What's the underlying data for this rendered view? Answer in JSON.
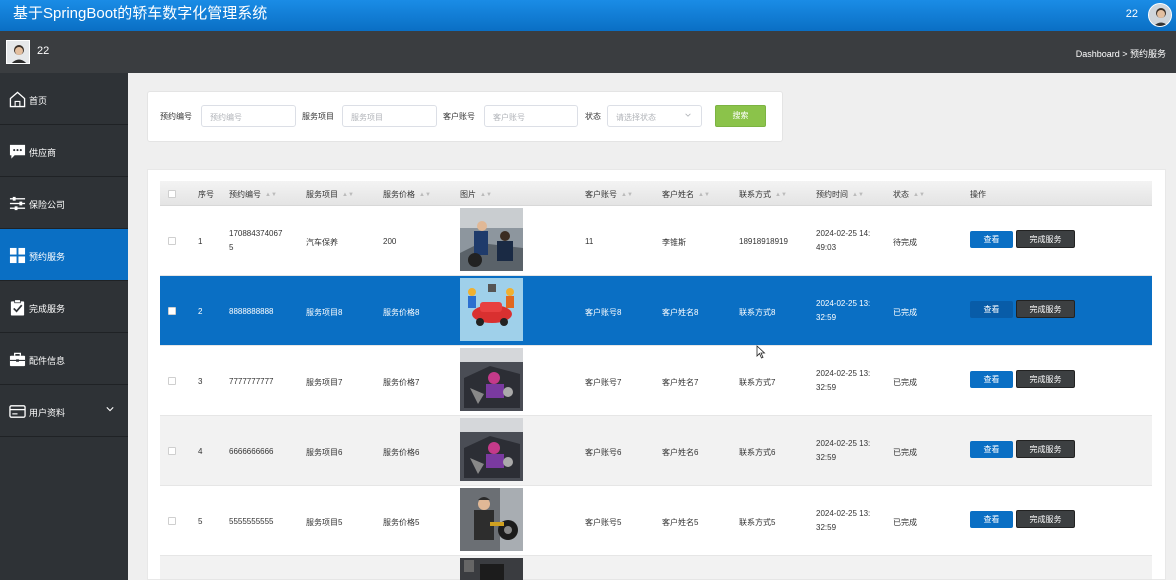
{
  "header": {
    "title": "基于SpringBoot的轿车数字化管理系统",
    "username": "22"
  },
  "subbar": {
    "username": "22",
    "breadcrumb": "Dashboard > 预约服务"
  },
  "sidebar": {
    "items": [
      {
        "label": "首页",
        "icon": "home-icon"
      },
      {
        "label": "供应商",
        "icon": "chat-icon"
      },
      {
        "label": "保险公司",
        "icon": "sliders-icon"
      },
      {
        "label": "预约服务",
        "icon": "grid-icon",
        "active": true
      },
      {
        "label": "完成服务",
        "icon": "clipboard-check-icon"
      },
      {
        "label": "配件信息",
        "icon": "toolbox-icon"
      },
      {
        "label": "用户资料",
        "icon": "card-icon",
        "expandable": true
      }
    ]
  },
  "search": {
    "fields": [
      {
        "label": "预约编号",
        "placeholder": "预约编号"
      },
      {
        "label": "服务项目",
        "placeholder": "服务项目"
      },
      {
        "label": "客户账号",
        "placeholder": "客户账号"
      }
    ],
    "status": {
      "label": "状态",
      "placeholder": "请选择状态"
    },
    "button": "搜索"
  },
  "table": {
    "headers": [
      "序号",
      "预约编号",
      "服务项目",
      "服务价格",
      "图片",
      "客户账号",
      "客户姓名",
      "联系方式",
      "预约时间",
      "状态",
      "操作"
    ],
    "view_label": "查看",
    "done_label": "完成服务",
    "rows": [
      {
        "index": "1",
        "booking_no": [
          "170884374067",
          "5"
        ],
        "item": "汽车保养",
        "price": "200",
        "account": "11",
        "name": "李锥斯",
        "phone": "18918918919",
        "time": [
          "2024-02-25 14:",
          "49:03"
        ],
        "status": "待完成"
      },
      {
        "index": "2",
        "booking_no": [
          "8888888888"
        ],
        "item": "服务项目8",
        "price": "服务价格8",
        "account": "客户账号8",
        "name": "客户姓名8",
        "phone": "联系方式8",
        "time": [
          "2024-02-25 13:",
          "32:59"
        ],
        "status": "已完成"
      },
      {
        "index": "3",
        "booking_no": [
          "7777777777"
        ],
        "item": "服务项目7",
        "price": "服务价格7",
        "account": "客户账号7",
        "name": "客户姓名7",
        "phone": "联系方式7",
        "time": [
          "2024-02-25 13:",
          "32:59"
        ],
        "status": "已完成"
      },
      {
        "index": "4",
        "booking_no": [
          "6666666666"
        ],
        "item": "服务项目6",
        "price": "服务价格6",
        "account": "客户账号6",
        "name": "客户姓名6",
        "phone": "联系方式6",
        "time": [
          "2024-02-25 13:",
          "32:59"
        ],
        "status": "已完成"
      },
      {
        "index": "5",
        "booking_no": [
          "5555555555"
        ],
        "item": "服务项目5",
        "price": "服务价格5",
        "account": "客户账号5",
        "name": "客户姓名5",
        "phone": "联系方式5",
        "time": [
          "2024-02-25 13:",
          "32:59"
        ],
        "status": "已完成"
      }
    ]
  },
  "colors": {
    "primary": "#0a6fc4",
    "sidebar": "#2e3236",
    "search_button": "#8bc34a",
    "dark_button": "#3c3f41"
  }
}
